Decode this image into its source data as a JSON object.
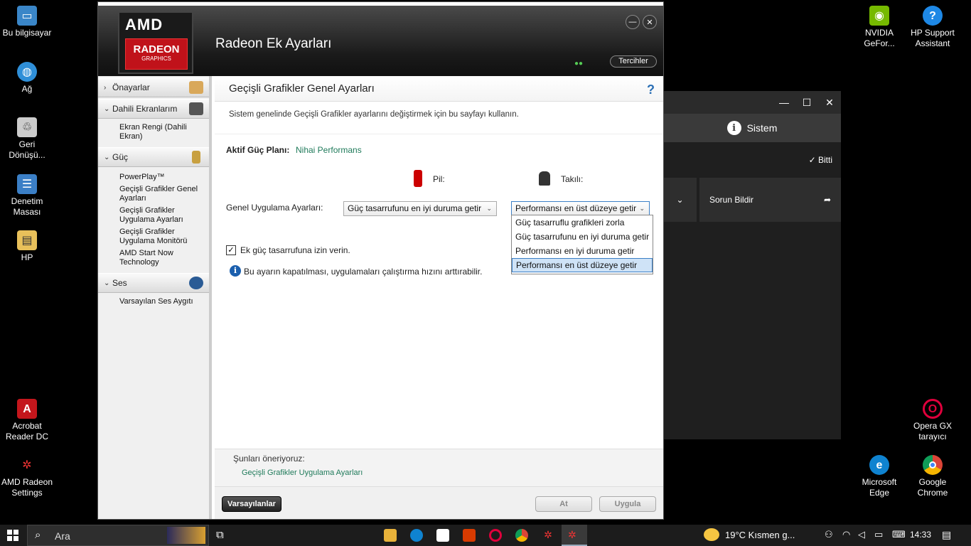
{
  "desktop": {
    "left_icons": [
      {
        "label": "Bu bilgisayar"
      },
      {
        "label": "Ağ"
      },
      {
        "label": "Geri Dönüşü..."
      },
      {
        "label": "Denetim Masası"
      },
      {
        "label": "HP"
      },
      {
        "label": "Acrobat Reader DC"
      },
      {
        "label": "AMD Radeon Settings"
      }
    ],
    "right_icons": [
      {
        "label": "NVIDIA GeFor..."
      },
      {
        "label": "HP Support Assistant"
      },
      {
        "label": "Opera GX tarayıcı"
      },
      {
        "label": "Microsoft Edge"
      },
      {
        "label": "Google Chrome"
      }
    ]
  },
  "bg_window": {
    "header": "Sistem",
    "done": "Bitti",
    "report": "Sorun Bildir"
  },
  "amd": {
    "logo_top": "AMD",
    "logo_mid": "RADEON",
    "logo_bottom": "GRAPHICS",
    "title": "Radeon Ek Ayarları",
    "preferences": "Tercihler",
    "sidebar": {
      "sections": [
        {
          "label": "Önayarlar"
        },
        {
          "label": "Dahili Ekranlarım",
          "items": [
            "Ekran Rengi (Dahili Ekran)"
          ]
        },
        {
          "label": "Güç",
          "items": [
            "PowerPlay™",
            "Geçişli Grafikler Genel Ayarları",
            "Geçişli Grafikler Uygulama Ayarları",
            "Geçişli Grafikler Uygulama Monitörü",
            "AMD Start Now Technology"
          ]
        },
        {
          "label": "Ses",
          "items": [
            "Varsayılan Ses Aygıtı"
          ]
        }
      ]
    },
    "page": {
      "title": "Geçişli Grafikler Genel Ayarları",
      "help": "?",
      "description": "Sistem genelinde Geçişli Grafikler ayarlarını değiştirmek için bu sayfayı kullanın.",
      "plan_label": "Aktif Güç Planı:",
      "plan_value": "Nihai Performans",
      "battery_label": "Pil:",
      "plugged_label": "Takılı:",
      "general_label": "Genel Uygulama Ayarları:",
      "battery_select": "Güç tasarrufunu en iyi duruma getir",
      "plugged_select": "Performansı en üst düzeye getir",
      "options": [
        "Güç tasarruflu grafikleri zorla",
        "Güç tasarrufunu en iyi duruma getir",
        "Performansı en iyi duruma getir",
        "Performansı en üst düzeye getir"
      ],
      "checkbox_label": "Ek güç tasarrufuna izin verin.",
      "info": "Bu ayarın kapatılması, uygulamaları çalıştırma hızını arttırabilir.",
      "suggest_title": "Şunları öneriyoruz:",
      "suggest_link": "Geçişli Grafikler Uygulama Ayarları",
      "defaults_btn": "Varsayılanlar",
      "discard_btn": "At",
      "apply_btn": "Uygula"
    }
  },
  "taskbar": {
    "search": "Ara",
    "weather": "19°C  Kısmen g...",
    "time": "14:33"
  }
}
